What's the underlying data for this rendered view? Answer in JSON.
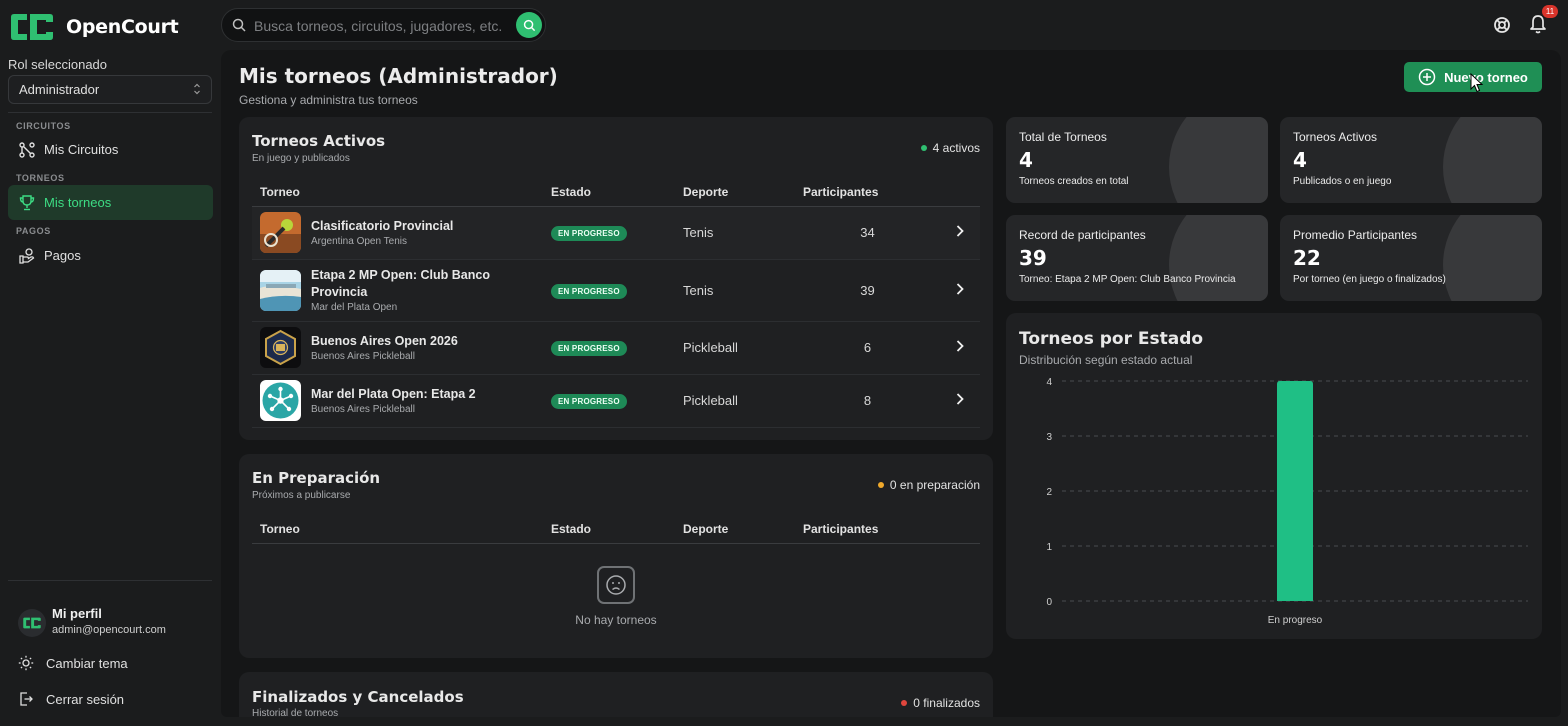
{
  "brand": {
    "name": "OpenCourt"
  },
  "search": {
    "placeholder": "Busca torneos, circuitos, jugadores, etc."
  },
  "topbar": {
    "notifications_count": "11"
  },
  "sidebar": {
    "role_label": "Rol seleccionado",
    "role_value": "Administrador",
    "sections": {
      "circuitos": "CIRCUITOS",
      "torneos": "TORNEOS",
      "pagos": "PAGOS"
    },
    "items": {
      "circuitos": "Mis Circuitos",
      "torneos": "Mis torneos",
      "pagos": "Pagos"
    },
    "profile": {
      "name": "Mi perfil",
      "email": "admin@opencourt.com"
    },
    "theme": "Cambiar tema",
    "logout": "Cerrar sesión"
  },
  "header": {
    "title": "Mis torneos (Administrador)",
    "subtitle": "Gestiona y administra tus torneos",
    "new_button": "Nuevo torneo"
  },
  "columns": [
    "Torneo",
    "Estado",
    "Deporte",
    "Participantes"
  ],
  "active": {
    "title": "Torneos Activos",
    "subtitle": "En juego y publicados",
    "count": "4 activos",
    "rows": [
      {
        "name": "Clasificatorio Provincial",
        "circuit": "Argentina Open Tenis",
        "status": "EN PROGRESO",
        "sport": "Tenis",
        "participants": "34"
      },
      {
        "name": "Etapa 2 MP Open: Club Banco Provincia",
        "circuit": "Mar del Plata Open",
        "status": "EN PROGRESO",
        "sport": "Tenis",
        "participants": "39"
      },
      {
        "name": "Buenos Aires Open 2026",
        "circuit": "Buenos Aires Pickleball",
        "status": "EN PROGRESO",
        "sport": "Pickleball",
        "participants": "6"
      },
      {
        "name": "Mar del Plata Open: Etapa 2",
        "circuit": "Buenos Aires Pickleball",
        "status": "EN PROGRESO",
        "sport": "Pickleball",
        "participants": "8"
      }
    ]
  },
  "preparation": {
    "title": "En Preparación",
    "subtitle": "Próximos a publicarse",
    "count": "0 en preparación",
    "empty": "No hay torneos"
  },
  "finished": {
    "title": "Finalizados y Cancelados",
    "subtitle": "Historial de torneos",
    "count": "0 finalizados"
  },
  "stats": [
    {
      "label": "Total de Torneos",
      "value": "4",
      "desc": "Torneos creados en total"
    },
    {
      "label": "Torneos Activos",
      "value": "4",
      "desc": "Publicados o en juego"
    },
    {
      "label": "Record de participantes",
      "value": "39",
      "desc": "Torneo: Etapa 2 MP Open: Club Banco Provincia"
    },
    {
      "label": "Promedio Participantes",
      "value": "22",
      "desc": "Por torneo (en juego o finalizados)"
    }
  ],
  "colors": {
    "accent": "#2fbf71",
    "bar": "#1fbf85",
    "badge": "#1e8a57",
    "warning": "#f0a92b",
    "danger": "#e0463d"
  },
  "chart_data": {
    "type": "bar",
    "title": "Torneos por Estado",
    "subtitle": "Distribución según estado actual",
    "categories": [
      "En progreso"
    ],
    "values": [
      4
    ],
    "yticks": [
      "0",
      "1",
      "2",
      "3",
      "4"
    ],
    "ylim": [
      0,
      4
    ],
    "grid": true
  }
}
